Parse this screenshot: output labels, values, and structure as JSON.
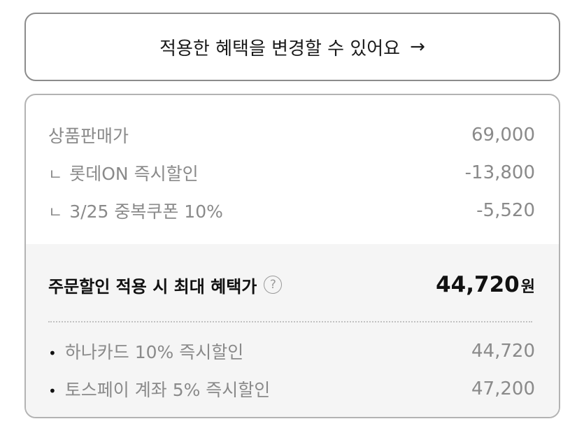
{
  "change_benefit_button": {
    "label": "적용한 혜택을 변경할 수 있어요",
    "arrow": "→"
  },
  "price_breakdown": {
    "items": [
      {
        "prefix": "",
        "label": "상품판매가",
        "value": "69,000"
      },
      {
        "prefix": "ㄴ",
        "label": "롯데ON 즉시할인",
        "value": "-13,800"
      },
      {
        "prefix": "ㄴ",
        "label": "3/25 중복쿠폰 10%",
        "value": "-5,520"
      }
    ]
  },
  "max_benefit": {
    "label": "주문할인 적용 시 최대 혜택가",
    "help_icon": "?",
    "amount": "44,720",
    "unit": "원"
  },
  "card_discounts": {
    "items": [
      {
        "bullet": "•",
        "label": "하나카드 10% 즉시할인",
        "value": "44,720"
      },
      {
        "bullet": "•",
        "label": "토스페이 계좌 5% 즉시할인",
        "value": "47,200"
      }
    ]
  }
}
